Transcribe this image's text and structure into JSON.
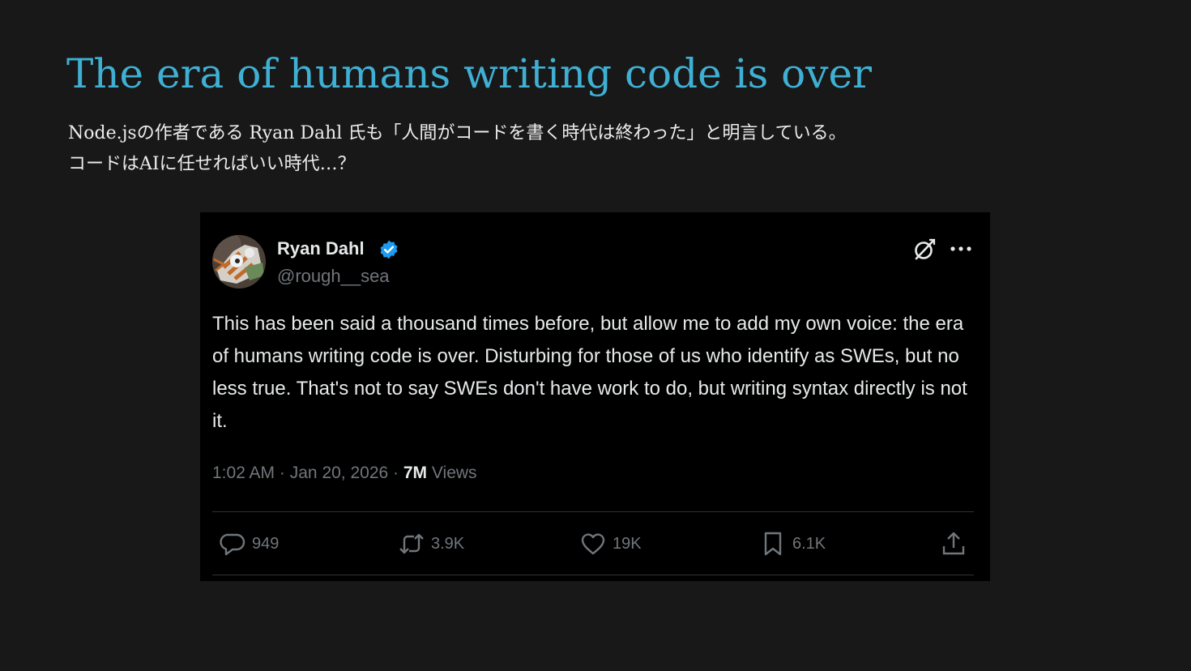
{
  "slide": {
    "title": "The era of humans writing code is over",
    "subtitle_lines": [
      "Node.jsの作者である Ryan Dahl 氏も「人間がコードを書く時代は終わった」と明言している。",
      "コードはAIに任せればいい時代…？"
    ]
  },
  "tweet": {
    "author": {
      "display_name": "Ryan Dahl",
      "handle": "@rough__sea",
      "verified": true,
      "verified_color": "#1d9bf0"
    },
    "text": "This has been said a thousand times before, but allow me to add my own voice: the era of humans writing code is over. Disturbing for those of us who identify as SWEs, but no less true. That's not to say SWEs don't have work to do, but writing syntax directly is not it.",
    "time": "1:02 AM",
    "separator": "·",
    "date": "Jan 20, 2026",
    "views_count": "7M",
    "views_label": "Views",
    "actions": {
      "replies": "949",
      "reposts": "3.9K",
      "likes": "19K",
      "bookmarks": "6.1K"
    },
    "icons": {
      "grok": "grok-icon",
      "more": "more-dots-icon",
      "reply": "reply-icon",
      "repost": "repost-icon",
      "like": "heart-icon",
      "bookmark": "bookmark-icon",
      "share": "share-icon",
      "verified": "verified-badge-icon"
    }
  },
  "colors": {
    "background": "#181818",
    "title": "#3fb0d3",
    "subtitle": "#ececec",
    "tweet_bg": "#000000",
    "tweet_text": "#e7e9ea",
    "muted": "#71767b",
    "divider": "#2f3336"
  }
}
